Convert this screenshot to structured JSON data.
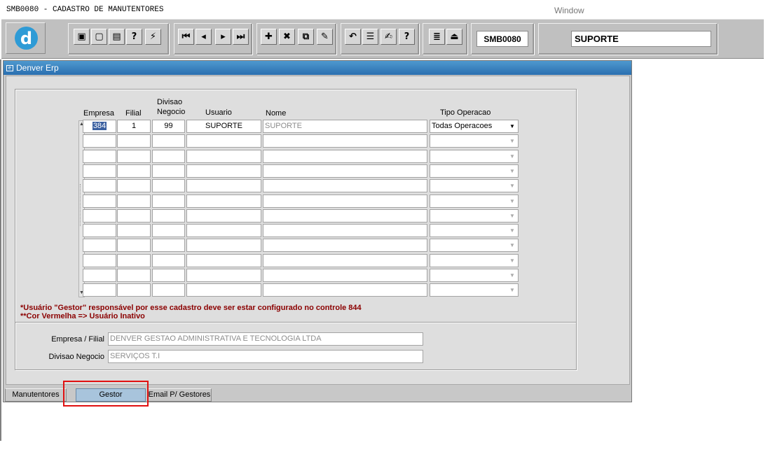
{
  "app": {
    "title": "SMB0080 - CADASTRO DE MANUTENTORES",
    "menu_window": "Window"
  },
  "toolbar": {
    "logo_letter": "d",
    "form_code": "SMB0080",
    "user": "SUPORTE",
    "buttons": [
      {
        "name": "save-icon",
        "glyph": "▣"
      },
      {
        "name": "print-screen-icon",
        "glyph": "▢"
      },
      {
        "name": "print-icon",
        "glyph": "▤"
      },
      {
        "name": "query-icon",
        "glyph": "?"
      },
      {
        "name": "execute-query-icon",
        "glyph": "⚡"
      },
      {
        "name": "first-record-icon",
        "glyph": "⏮"
      },
      {
        "name": "previous-record-icon",
        "glyph": "◂"
      },
      {
        "name": "next-record-icon",
        "glyph": "▸"
      },
      {
        "name": "last-record-icon",
        "glyph": "⏭"
      },
      {
        "name": "insert-record-icon",
        "glyph": "✚"
      },
      {
        "name": "delete-record-icon",
        "glyph": "✖"
      },
      {
        "name": "duplicate-record-icon",
        "glyph": "⧉"
      },
      {
        "name": "clear-record-icon",
        "glyph": "✎"
      },
      {
        "name": "undo-icon",
        "glyph": "↶"
      },
      {
        "name": "list-values-icon",
        "glyph": "☰"
      },
      {
        "name": "edit-icon",
        "glyph": "✍"
      },
      {
        "name": "help-icon",
        "glyph": "?"
      },
      {
        "name": "menu-icon",
        "glyph": "≣"
      },
      {
        "name": "exit-icon",
        "glyph": "⏏"
      }
    ]
  },
  "window": {
    "title": "Denver Erp"
  },
  "grid": {
    "headers": {
      "empresa": "Empresa",
      "filial": "Filial",
      "divisao_line1": "Divisao",
      "divisao_line2": "Negocio",
      "usuario": "Usuario",
      "nome": "Nome",
      "tipo_operacao": "Tipo Operacao"
    },
    "rows": [
      {
        "empresa": "384",
        "filial": "1",
        "divisao": "99",
        "usuario": "SUPORTE",
        "nome": "SUPORTE",
        "tipo_operacao": "Todas Operacoes"
      },
      {
        "empresa": "",
        "filial": "",
        "divisao": "",
        "usuario": "",
        "nome": "",
        "tipo_operacao": ""
      },
      {
        "empresa": "",
        "filial": "",
        "divisao": "",
        "usuario": "",
        "nome": "",
        "tipo_operacao": ""
      },
      {
        "empresa": "",
        "filial": "",
        "divisao": "",
        "usuario": "",
        "nome": "",
        "tipo_operacao": ""
      },
      {
        "empresa": "",
        "filial": "",
        "divisao": "",
        "usuario": "",
        "nome": "",
        "tipo_operacao": ""
      },
      {
        "empresa": "",
        "filial": "",
        "divisao": "",
        "usuario": "",
        "nome": "",
        "tipo_operacao": ""
      },
      {
        "empresa": "",
        "filial": "",
        "divisao": "",
        "usuario": "",
        "nome": "",
        "tipo_operacao": ""
      },
      {
        "empresa": "",
        "filial": "",
        "divisao": "",
        "usuario": "",
        "nome": "",
        "tipo_operacao": ""
      },
      {
        "empresa": "",
        "filial": "",
        "divisao": "",
        "usuario": "",
        "nome": "",
        "tipo_operacao": ""
      },
      {
        "empresa": "",
        "filial": "",
        "divisao": "",
        "usuario": "",
        "nome": "",
        "tipo_operacao": ""
      },
      {
        "empresa": "",
        "filial": "",
        "divisao": "",
        "usuario": "",
        "nome": "",
        "tipo_operacao": ""
      },
      {
        "empresa": "",
        "filial": "",
        "divisao": "",
        "usuario": "",
        "nome": "",
        "tipo_operacao": ""
      }
    ]
  },
  "notes": {
    "line1": "*Usuário \"Gestor\" responsável por esse cadastro deve ser estar configurado no controle 844",
    "line2": "**Cor Vermelha => Usuário Inativo"
  },
  "details": {
    "empresa_filial_label": "Empresa / Filial",
    "empresa_filial_value": "DENVER GESTAO ADMINISTRATIVA E TECNOLOGIA LTDA",
    "divisao_label": "Divisao Negocio",
    "divisao_value": "SERVIÇOS T.I"
  },
  "tabs": [
    {
      "label": "Manutentores",
      "active": false
    },
    {
      "label": "Gestor",
      "active": true
    },
    {
      "label": "Email P/ Gestores",
      "active": false
    }
  ]
}
